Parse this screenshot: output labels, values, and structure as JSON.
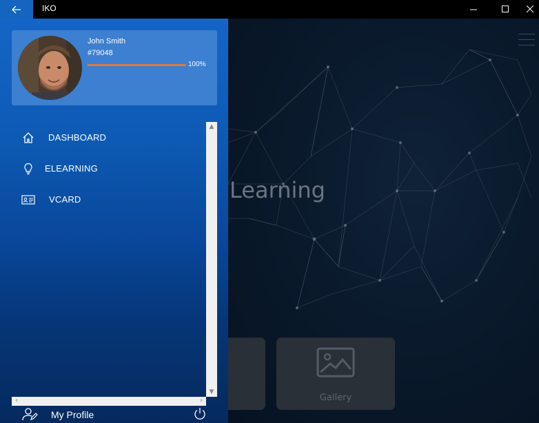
{
  "window": {
    "title": "IKO",
    "icons": {
      "back": "arrow-left-icon",
      "minimize": "minimize-icon",
      "maximize": "maximize-icon",
      "close": "close-icon"
    }
  },
  "profile": {
    "name": "John Smith",
    "id": "#79048",
    "progress": 1.0,
    "progress_label": "100%",
    "progress_color": "#e07a3a"
  },
  "nav": {
    "items": [
      {
        "label": "DASHBOARD",
        "icon": "home-icon"
      },
      {
        "label": "ELEARNING",
        "icon": "lightbulb-icon"
      },
      {
        "label": "VCARD",
        "icon": "id-card-icon"
      }
    ]
  },
  "footer": {
    "profile_label": "My Profile",
    "profile_icon": "user-edit-icon",
    "power_icon": "power-icon"
  },
  "main": {
    "hero_title": "Learning",
    "tiles": [
      {
        "label": "",
        "icon": ""
      },
      {
        "label": "Gallery",
        "icon": "image-icon"
      }
    ],
    "menu_icon": "hamburger-icon"
  },
  "colors": {
    "drawer_top": "#1565c8",
    "drawer_bottom": "#052a5e",
    "card": "#3d7fd0",
    "accent": "#e07a3a",
    "back_button": "#1565c0"
  }
}
